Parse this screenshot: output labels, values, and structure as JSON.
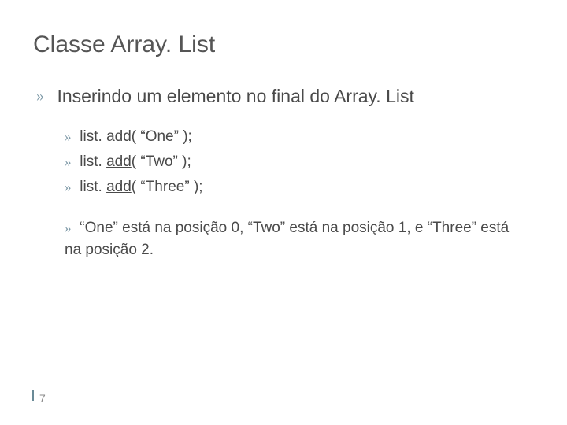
{
  "title": "Classe Array. List",
  "level1_text": "Inserindo um elemento no final do Array. List",
  "sub": {
    "items": [
      {
        "pre": "list. ",
        "method": "add",
        "post": "( “One” );"
      },
      {
        "pre": "list. ",
        "method": "add",
        "post": "( “Two” );"
      },
      {
        "pre": "list. ",
        "method": "add",
        "post": "( “Three” );"
      }
    ],
    "note": "“One” está na posição 0, “Two” está na posição 1, e “Three” está na posição 2."
  },
  "page_number": "7",
  "bullet_glyph": "»"
}
